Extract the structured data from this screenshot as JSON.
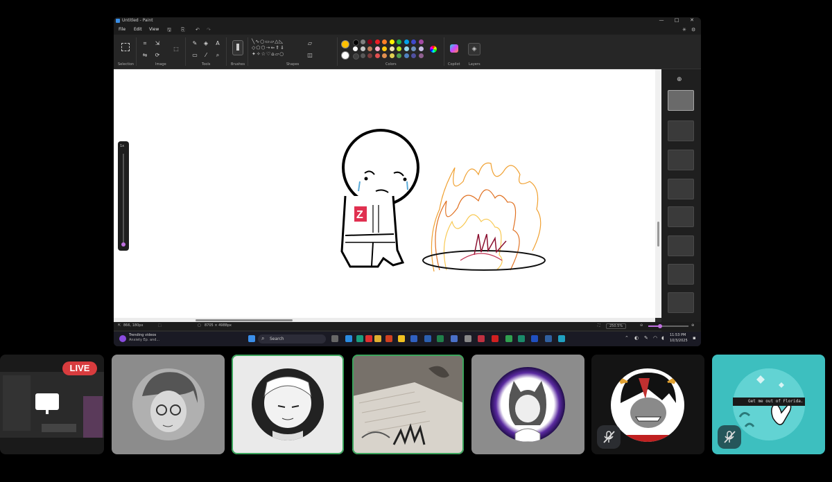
{
  "window": {
    "title": "Untitled - Paint",
    "controls": {
      "minimize": "—",
      "maximize": "□",
      "close": "✕"
    }
  },
  "menu": {
    "items": [
      "File",
      "Edit",
      "View"
    ],
    "settings_icon": "gear-icon"
  },
  "ribbon": {
    "groups": [
      "Selection",
      "Image",
      "Tools",
      "Brushes",
      "Shapes",
      "Colors",
      "Copilot",
      "Layers"
    ],
    "colors": [
      "#000000",
      "#7f7f7f",
      "#880015",
      "#ed1c24",
      "#ff7f27",
      "#fff200",
      "#22b14c",
      "#00a2e8",
      "#3f48cc",
      "#a349a4",
      "#ffffff",
      "#c3c3c3",
      "#b97a57",
      "#ffaec9",
      "#ffc90e",
      "#efe4b0",
      "#b5e61d",
      "#99d9ea",
      "#7092be",
      "#c8bfe7",
      "#404040",
      "#585858",
      "#7a3c3c",
      "#e05050",
      "#e09050",
      "#e0d050",
      "#50a050",
      "#5080c0",
      "#5050a0",
      "#906090"
    ],
    "primary_color": "#ffc000",
    "secondary_color": "#ffffff"
  },
  "zoom_slider": {
    "label": "1x"
  },
  "status": {
    "cursor": "866, 180px",
    "canvas_size": "8705 × 4988px",
    "zoom": "250.5%",
    "zoom_level_fraction": 0.3
  },
  "taskbar": {
    "widget_line1": "Trending videos",
    "widget_line2": "Anxiety Ep. and...",
    "search_label": "Search",
    "time": "11:53 PM",
    "date": "10/3/2025"
  },
  "tiles": [
    {
      "id": "stream",
      "live_label": "LIVE",
      "speaking": false,
      "muted": false
    },
    {
      "id": "user-2",
      "speaking": false,
      "muted": false
    },
    {
      "id": "user-3",
      "speaking": true,
      "muted": false
    },
    {
      "id": "user-4-camera",
      "speaking": true,
      "muted": false
    },
    {
      "id": "user-5",
      "speaking": false,
      "muted": false
    },
    {
      "id": "user-6",
      "speaking": false,
      "muted": true
    },
    {
      "id": "user-7",
      "speaking": false,
      "muted": true,
      "banner_text": "Get me out of Florida."
    }
  ],
  "colors": {
    "speaking_outline": "#3ba55c",
    "live_red": "#d83c3e",
    "teal_tile": "#3dbfbf"
  }
}
